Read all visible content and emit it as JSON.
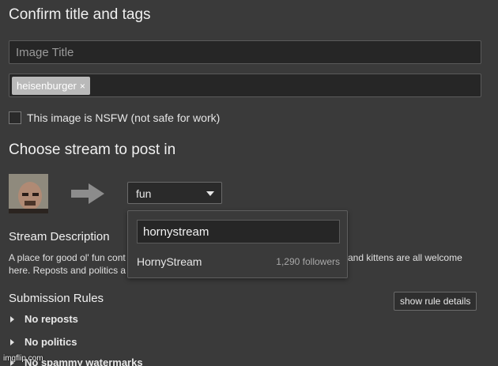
{
  "header": {
    "title": "Confirm title and tags"
  },
  "title_field": {
    "placeholder": "Image Title",
    "value": ""
  },
  "tags": {
    "items": [
      {
        "label": "heisenburger",
        "remove": "×"
      }
    ]
  },
  "nsfw": {
    "label": "This image is NSFW (not safe for work)",
    "checked": false
  },
  "stream_section": {
    "title": "Choose stream to post in"
  },
  "stream_select": {
    "value": "fun"
  },
  "stream_dropdown": {
    "search_value": "hornystream",
    "results": [
      {
        "name": "HornyStream",
        "followers": "1,290 followers"
      }
    ]
  },
  "description": {
    "title": "Stream Description",
    "line1_left": "A place for good ol' fun cont",
    "line1_right": "and kittens are all welcome",
    "line2_left": "here. Reposts and politics a"
  },
  "rules": {
    "title": "Submission Rules",
    "details_button": "show rule details",
    "items": [
      "No reposts",
      "No politics",
      "No spammy watermarks"
    ]
  },
  "watermark": "imgflip.com"
}
